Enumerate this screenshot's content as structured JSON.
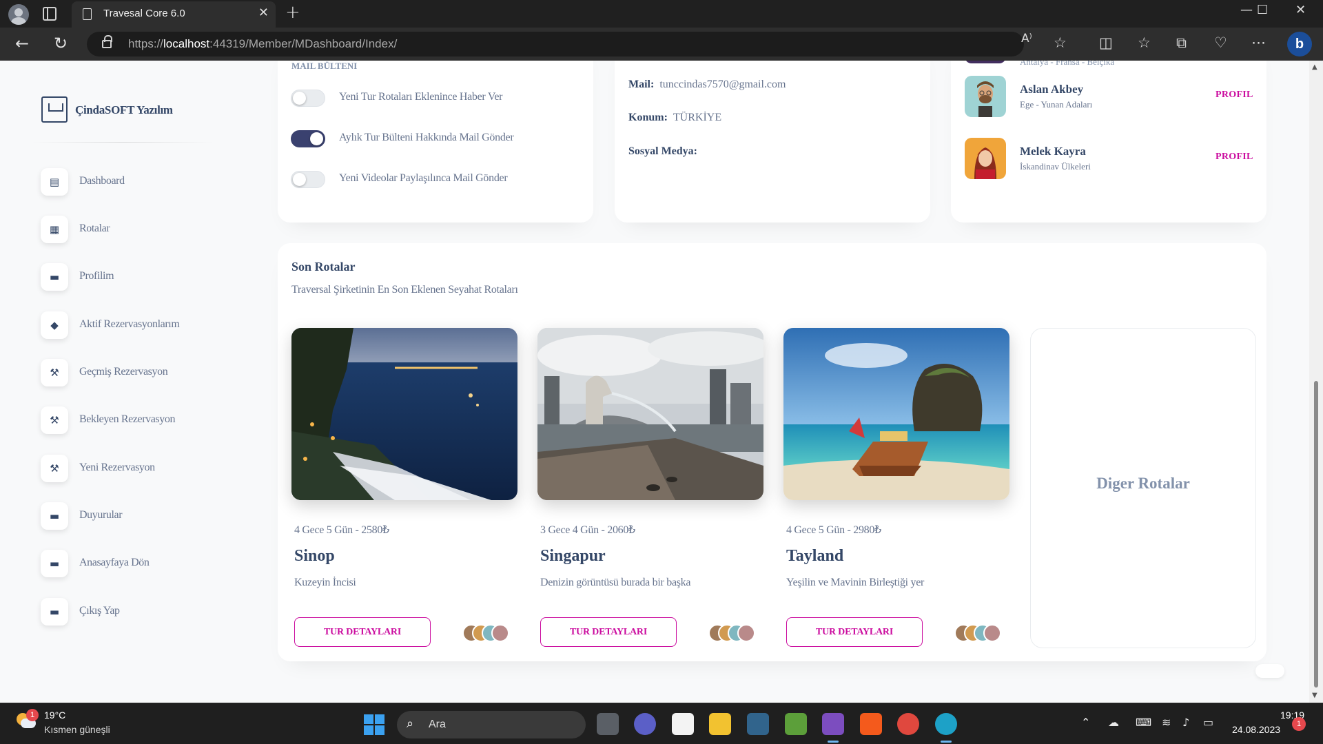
{
  "browser": {
    "tab_title": "Travesal Core 6.0",
    "url_scheme": "https://",
    "url_host": "localhost",
    "url_rest": ":44319/Member/MDashboard/Index/",
    "read_aloud": "A⁾",
    "new_tab": "+",
    "close_tab": "✕",
    "window_min": "—",
    "window_max": "☐",
    "window_close": "✕",
    "back": "←",
    "refresh": "↻",
    "menu_dots": "⋯",
    "bing": "b"
  },
  "sidebar": {
    "brand": "ÇindaSOFT Yazılım",
    "items": [
      {
        "label": "Dashboard",
        "icon": "▤"
      },
      {
        "label": "Rotalar",
        "icon": "▦"
      },
      {
        "label": "Profilim",
        "icon": "▬"
      },
      {
        "label": "Aktif Rezervasyonlarım",
        "icon": "◆"
      },
      {
        "label": "Geçmiş Rezervasyon",
        "icon": "⚒"
      },
      {
        "label": "Bekleyen Rezervasyon",
        "icon": "⚒"
      },
      {
        "label": "Yeni Rezervasyon",
        "icon": "⚒"
      },
      {
        "label": "Duyurular",
        "icon": "▬"
      },
      {
        "label": "Anasayfaya Dön",
        "icon": "▬"
      },
      {
        "label": "Çıkış Yap",
        "icon": "▬"
      }
    ]
  },
  "mail_settings": {
    "heading": "MAIL BÜLTENI",
    "options": [
      {
        "label": "Yeni Tur Rotaları Eklenince Haber Ver",
        "on": false
      },
      {
        "label": "Aylık Tur Bülteni Hakkında Mail Gönder",
        "on": true
      },
      {
        "label": "Yeni Videolar Paylaşılınca Mail Gönder",
        "on": false
      }
    ]
  },
  "profile_info": {
    "mail_key": "Mail:",
    "mail_value": "tunccindas7570@gmail.com",
    "location_key": "Konum:",
    "location_value": "TÜRKİYE",
    "social_key": "Sosyal Medya:"
  },
  "guides": {
    "partial_region": "Antalya - Fransa - Belçika",
    "list": [
      {
        "name": "Aslan Akbey",
        "region": "Ege - Yunan Adaları",
        "action": "PROFIL"
      },
      {
        "name": "Melek Kayra",
        "region": "İskandinav Ülkeleri",
        "action": "PROFIL"
      }
    ]
  },
  "recent_routes": {
    "title": "Son Rotalar",
    "subtitle": "Traversal Şirketinin En Son Eklenen Seyahat Rotaları",
    "button_label": "TUR DETAYLARI",
    "more_label": "Diger Rotalar",
    "tours": [
      {
        "meta": "4 Gece 5 Gün - 2580₺",
        "name": "Sinop",
        "desc": "Kuzeyin İncisi"
      },
      {
        "meta": "3 Gece 4 Gün - 2060₺",
        "name": "Singapur",
        "desc": "Denizin görüntüsü burada bir başka"
      },
      {
        "meta": "4 Gece 5 Gün - 2980₺",
        "name": "Tayland",
        "desc": "Yeşilin ve Mavinin Birleştiği yer"
      }
    ]
  },
  "taskbar": {
    "temperature": "19°C",
    "condition": "Kısmen güneşli",
    "weather_badge": "1",
    "search_placeholder": "Ara",
    "time": "19:19",
    "date": "24.08.2023",
    "notification_count": "1"
  },
  "colors": {
    "primary_text": "#344767",
    "secondary_text": "#67748e",
    "accent": "#cb0c9f",
    "toggle_on": "#3a416f"
  }
}
